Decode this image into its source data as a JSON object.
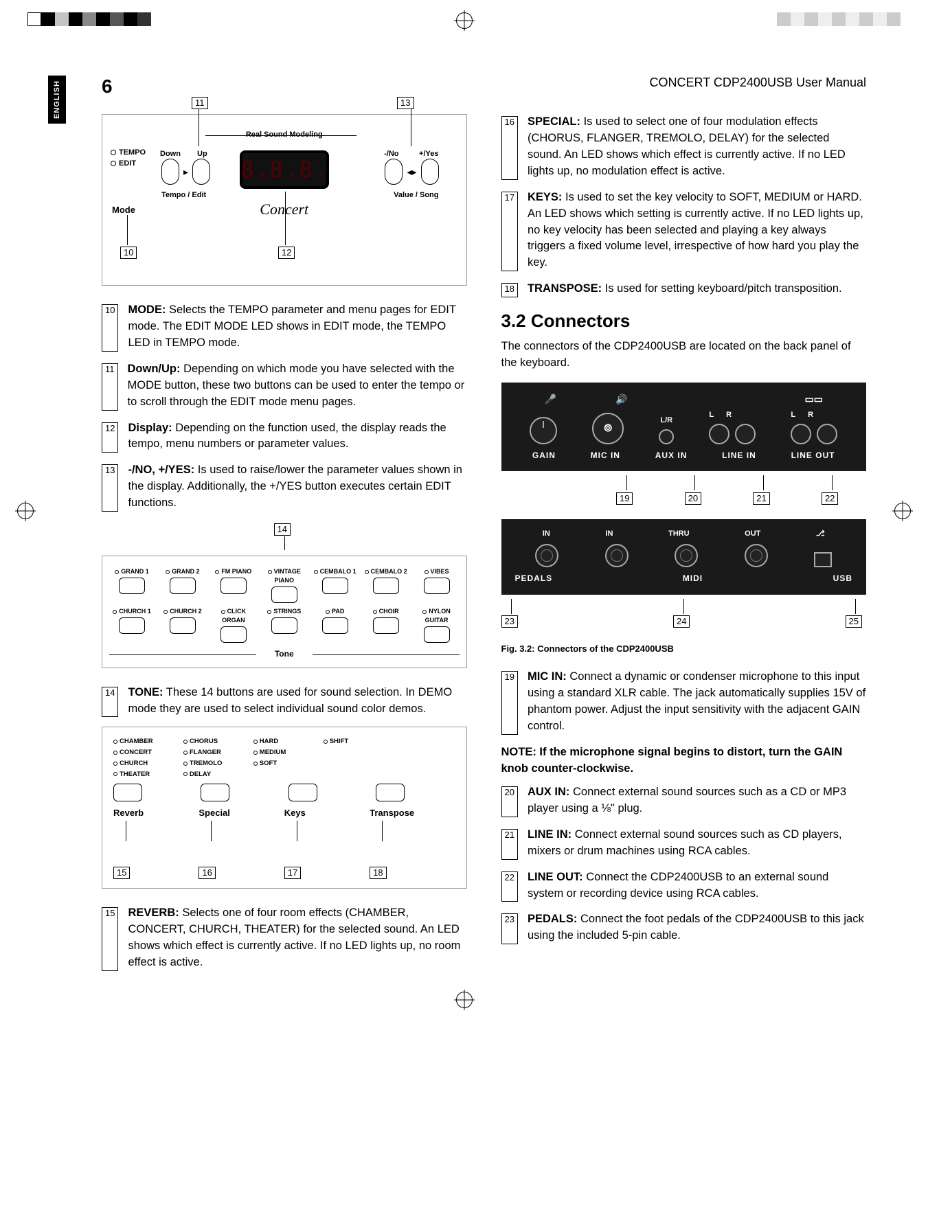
{
  "page_number": "6",
  "manual_title": "CONCERT CDP2400USB User Manual",
  "side_tab": "ENGLISH",
  "fig1": {
    "rsm_label": "Real Sound Modeling",
    "mode_leds": [
      "TEMPO",
      "EDIT"
    ],
    "down": "Down",
    "up": "Up",
    "no": "-/No",
    "yes": "+/Yes",
    "tempo_edit": "Tempo / Edit",
    "value_song": "Value / Song",
    "mode": "Mode",
    "concert": "Concert",
    "display_text": "8.8.8.",
    "callouts": {
      "c10": "10",
      "c11": "11",
      "c12": "12",
      "c13": "13"
    }
  },
  "entries_left_a": [
    {
      "n": "10",
      "term": "MODE:",
      "text": " Selects the TEMPO parameter and menu pages for EDIT mode. The EDIT MODE LED shows in EDIT mode, the TEMPO LED in TEMPO mode."
    },
    {
      "n": "11",
      "term": "Down/Up:",
      "text": " Depending on which mode you have selected with the MODE button, these two buttons can be used to enter the tempo or to scroll through the EDIT mode menu pages."
    },
    {
      "n": "12",
      "term": "Display:",
      "text": " Depending on the function used, the display reads the tempo, menu numbers or parameter values."
    },
    {
      "n": "13",
      "term": "-/NO, +/YES:",
      "text": " Is used to raise/lower the parameter values shown in the display. Additionally, the +/YES button executes certain EDIT functions."
    }
  ],
  "fig2": {
    "callout": "14",
    "tone_top": [
      "GRAND 1",
      "GRAND 2",
      "FM PIANO",
      "VINTAGE PIANO",
      "CEMBALO 1",
      "CEMBALO 2",
      "VIBES"
    ],
    "tone_bottom": [
      "CHURCH 1",
      "CHURCH 2",
      "CLICK ORGAN",
      "STRINGS",
      "PAD",
      "CHOIR",
      "NYLON GUITAR"
    ],
    "title": "Tone"
  },
  "entries_left_b": [
    {
      "n": "14",
      "term": "TONE:",
      "text": " These 14 buttons are used for sound selection. In DEMO mode they are used to select individual sound color demos."
    }
  ],
  "fig3": {
    "reverb_opts": [
      "CHAMBER",
      "CONCERT",
      "CHURCH",
      "THEATER"
    ],
    "special_opts": [
      "CHORUS",
      "FLANGER",
      "TREMOLO",
      "DELAY"
    ],
    "keys_opts": [
      "HARD",
      "MEDIUM",
      "SOFT"
    ],
    "transpose_opts": [
      "SHIFT"
    ],
    "labels": [
      "Reverb",
      "Special",
      "Keys",
      "Transpose"
    ],
    "callouts": [
      "15",
      "16",
      "17",
      "18"
    ]
  },
  "entries_left_c": [
    {
      "n": "15",
      "term": "REVERB:",
      "text": " Selects one of four room effects (CHAMBER, CONCERT, CHURCH, THEATER) for the selected sound. An LED shows which effect is currently active. If no LED lights up, no room effect is active."
    }
  ],
  "entries_right_a": [
    {
      "n": "16",
      "term": "SPECIAL:",
      "text": " Is used to select one of four modulation effects (CHORUS, FLANGER, TREMOLO, DELAY) for the selected sound. An LED shows which effect is currently active. If no LED lights up, no modulation effect is active."
    },
    {
      "n": "17",
      "term": "KEYS:",
      "text": " Is used to set the key velocity to SOFT, MEDIUM or HARD. An LED shows which setting is currently active. If no LED lights up, no key velocity has been selected and playing a key always triggers a fixed volume level, irrespective of how hard you play the key."
    },
    {
      "n": "18",
      "term": "TRANSPOSE:",
      "text": " Is used for setting keyboard/pitch transposition."
    }
  ],
  "section_title": "3.2  Connectors",
  "section_intro": "The connectors of the CDP2400USB are located on the back panel of the keyboard.",
  "fig4": {
    "top_labels": {
      "lr": "L/R",
      "l": "L",
      "r": "R"
    },
    "bottom_labels": [
      "GAIN",
      "MIC IN",
      "AUX IN",
      "LINE IN",
      "LINE OUT"
    ],
    "callouts": [
      "19",
      "20",
      "21",
      "22"
    ]
  },
  "fig5": {
    "top_labels": [
      "IN",
      "IN",
      "THRU",
      "OUT"
    ],
    "usb_icon": "usb",
    "bottom_labels": [
      "PEDALS",
      "MIDI",
      "USB"
    ],
    "callouts": [
      "23",
      "24",
      "25"
    ]
  },
  "fig_caption": "Fig. 3.2: Connectors of the CDP2400USB",
  "entries_right_b": [
    {
      "n": "19",
      "term": "MIC IN:",
      "text": " Connect a dynamic or condenser microphone to this input using a standard XLR cable. The jack automatically supplies 15V of phantom power. Adjust the input sensitivity with the adjacent GAIN control."
    }
  ],
  "note_text": "NOTE: If the microphone signal begins to distort, turn the GAIN knob counter-clockwise.",
  "entries_right_c": [
    {
      "n": "20",
      "term": "AUX IN:",
      "text": " Connect external sound sources such as a CD or MP3 player using a ⅛\" plug."
    },
    {
      "n": "21",
      "term": "LINE IN:",
      "text": " Connect external sound sources such as CD players, mixers or drum machines using RCA cables."
    },
    {
      "n": "22",
      "term": "LINE OUT:",
      "text": " Connect the CDP2400USB to an external sound system or recording device using RCA cables."
    },
    {
      "n": "23",
      "term": "PEDALS:",
      "text": " Connect the foot pedals of the CDP2400USB to this jack using the included 5-pin cable."
    }
  ]
}
